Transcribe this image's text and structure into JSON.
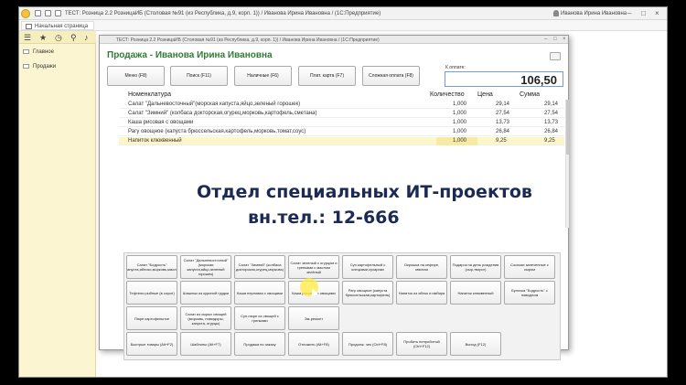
{
  "titlebar": {
    "title": "ТЕСТ: Розница 2.2 РозницаИБ (Столовая №91 (из Республика, д.9, корп. 1)) / Иванова Ирина Ивановна / (1С:Предприятие)",
    "user": "Иванова Ирина Ивановна"
  },
  "tabs": {
    "home": "Начальная страница"
  },
  "sidebar": {
    "items": [
      "Главное",
      "Продажи"
    ]
  },
  "dialog": {
    "window_title": "ТЕСТ: Розница 2.2 РозницаИБ (Столовая №91 (из Республика, д.9, корп. 1)) / Иванова Ирина Ивановна / (1С:Предприятие)",
    "heading": "Продажа - Иванова Ирина Ивановна",
    "buttons": [
      "Меню (F8)",
      "Поиск (F11)",
      "Наличные (F6)",
      "Плат. карта (F7)",
      "Сложная оплата (F8)"
    ],
    "pay_label": "К оплате:",
    "amount": "106,50"
  },
  "table": {
    "headers": {
      "name": "Номенклатура",
      "qty": "Количество",
      "price": "Цена",
      "sum": "Сумма"
    },
    "rows": [
      {
        "name": "Салат \"Дальневосточный\"(морская капуста,яйцо,зеленый горошек)",
        "qty": "1,000",
        "price": "29,14",
        "sum": "29,14"
      },
      {
        "name": "Салат \"Зимний\" (колбаса докторская,огурец,морковь,картофель,сметана)",
        "qty": "1,000",
        "price": "27,54",
        "sum": "27,54"
      },
      {
        "name": "Каша рисовая с овощами",
        "qty": "1,000",
        "price": "13,73",
        "sum": "13,73"
      },
      {
        "name": "Рагу овощное (капуста брюссельская,картофель,морковь,томат,соус)",
        "qty": "1,000",
        "price": "26,84",
        "sum": "26,84"
      },
      {
        "name": "Напиток клюквенный",
        "qty": "1,000",
        "price": "9,25",
        "sum": "9,25"
      }
    ]
  },
  "overlay": {
    "line1": "Отдел специальных ИТ-проектов",
    "line2": "вн.тел.: 12-666"
  },
  "product_buttons": [
    "Салат \"Бодрость\" (капуста,яблоко,морковь,масло)",
    "Салат \"Дальневосточный\" (морская капуста,яйцо,зеленый горошек)",
    "Салат \"Зимний\" (колбаса докторская,огурец,морковь)",
    "Салат зеленый с огурцом и гренками с маслом зелёный",
    "Суп картофельный с клецками,сухарики",
    "Окрошка на кефире, мясная",
    "Подарок на день рождения (сыр,творог)",
    "Сосиски запеченные с сыром",
    "Тефтели рыбные (в соусе)",
    "Шашлык из куриной грудки",
    "Каша перловая с овощами",
    "Каша рисовая с овощами",
    "Рагу овощное (капуста брюссельская,картофель)",
    "Напиток из яблок и имбиря",
    "Напиток клюквенный",
    "Булочка \"Бодрость\" с повидлом",
    "Пюре картофельное",
    "Салат из сырых овощей (морковь, помидоры, капуста, огурцы)",
    "Суп-пюре из овощей с гренками",
    "Эм-ремонт",
    "Быстрые товары (Alt+F2)",
    "Шаблоны (Alt+F7)",
    "Продажа по заказу",
    "Отложить (Alt+F8)",
    "Продолж. чек (Ctrl+F8)",
    "Пробить непробитый (Ctrl+F12)",
    "Выход (F12)"
  ],
  "colors": {
    "heading": "#2e7d32",
    "sidebar_bg": "#fbf5d1",
    "selected_row": "#fdf6c9"
  }
}
